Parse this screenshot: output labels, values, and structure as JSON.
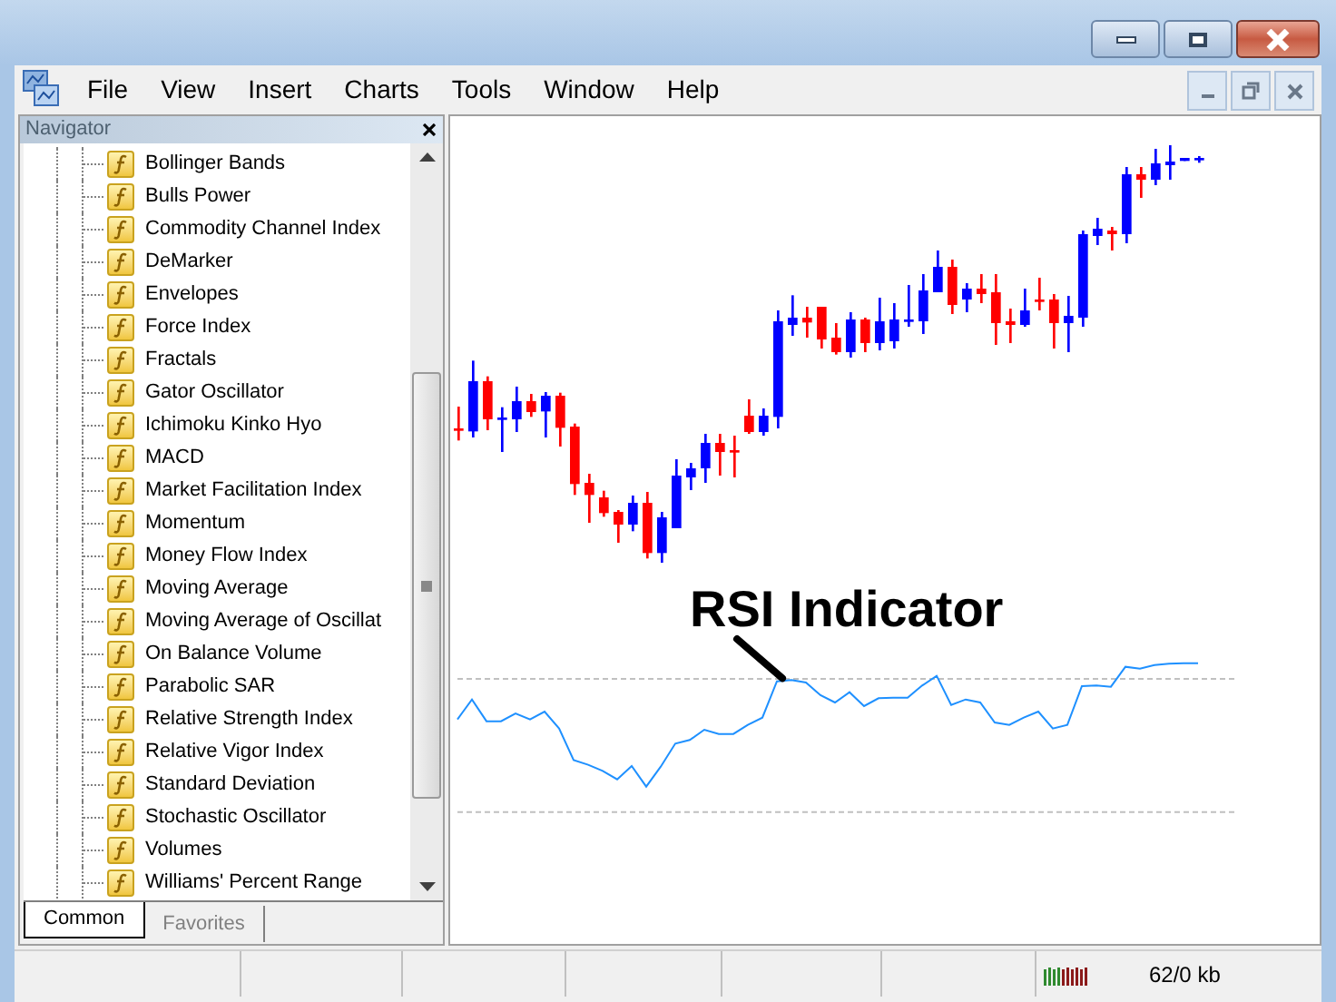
{
  "menu": [
    "File",
    "View",
    "Insert",
    "Charts",
    "Tools",
    "Window",
    "Help"
  ],
  "navigator": {
    "title": "Navigator",
    "items": [
      "Bollinger Bands",
      "Bulls Power",
      "Commodity Channel Index",
      "DeMarker",
      "Envelopes",
      "Force Index",
      "Fractals",
      "Gator Oscillator",
      "Ichimoku Kinko Hyo",
      "MACD",
      "Market Facilitation Index",
      "Momentum",
      "Money Flow Index",
      "Moving Average",
      "Moving Average of Oscillat",
      "On Balance Volume",
      "Parabolic SAR",
      "Relative Strength Index",
      "Relative Vigor Index",
      "Standard Deviation",
      "Stochastic Oscillator",
      "Volumes",
      "Williams' Percent Range"
    ],
    "tabs": [
      {
        "label": "Common",
        "selected": true
      },
      {
        "label": "Favorites",
        "selected": false
      }
    ]
  },
  "chart": {
    "annotation": "RSI Indicator"
  },
  "status_bar": {
    "traffic": "62/0 kb"
  }
}
